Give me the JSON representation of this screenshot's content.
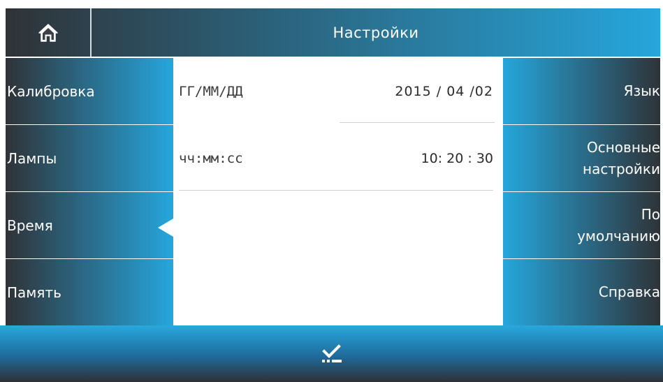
{
  "header": {
    "title": "Настройки",
    "home_icon": "home-icon"
  },
  "left_menu": {
    "items": [
      {
        "label": "Калибровка"
      },
      {
        "label": "Лампы"
      },
      {
        "label": "Время",
        "selected": true
      },
      {
        "label": "Память"
      }
    ]
  },
  "right_menu": {
    "items": [
      {
        "label": "Язык"
      },
      {
        "label": "Основные\nнастройки"
      },
      {
        "label": "По\nумолчанию"
      },
      {
        "label": "Справка"
      }
    ]
  },
  "content": {
    "date": {
      "label": "ГГ/ММ/ДД",
      "value": "2015 / 04  /02"
    },
    "time": {
      "label": "чч:мм:сс",
      "value": "10:  20 : 30"
    }
  },
  "footer": {
    "confirm_icon": "checkmark-icon"
  },
  "colors": {
    "accent": "#26a6dc",
    "dark": "#2f3338"
  }
}
